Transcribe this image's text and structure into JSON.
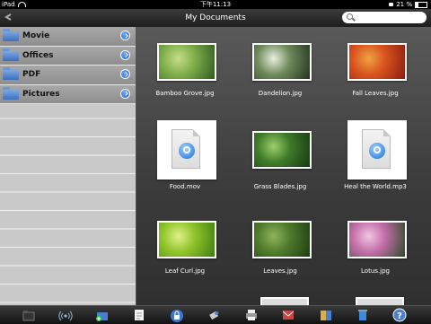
{
  "status": {
    "device": "iPad",
    "time": "下午11:13",
    "battery": "21 %"
  },
  "navbar": {
    "title": "My Documents",
    "search_placeholder": ""
  },
  "sidebar": {
    "items": [
      {
        "label": "Movie"
      },
      {
        "label": "Offices"
      },
      {
        "label": "PDF"
      },
      {
        "label": "Pictures"
      }
    ]
  },
  "files": [
    {
      "name": "Bamboo Grove.jpg",
      "kind": "photo",
      "palette": [
        "#2f5a1e",
        "#7fae4a",
        "#c8dc8a"
      ]
    },
    {
      "name": "Dandelion.jpg",
      "kind": "photo",
      "palette": [
        "#23331f",
        "#6f8a5b",
        "#e8efe0"
      ]
    },
    {
      "name": "Fall Leaves.jpg",
      "kind": "photo",
      "palette": [
        "#8a1c10",
        "#d9531e",
        "#f0a341"
      ]
    },
    {
      "name": "Food.mov",
      "kind": "movie",
      "palette": []
    },
    {
      "name": "Grass Blades.jpg",
      "kind": "photo",
      "palette": [
        "#163a12",
        "#3f7a2a",
        "#9ccf6a"
      ]
    },
    {
      "name": "Heal the World.mp3",
      "kind": "audio",
      "palette": []
    },
    {
      "name": "Leaf Curl.jpg",
      "kind": "photo",
      "palette": [
        "#3f7d12",
        "#8fc42a",
        "#e0f08a"
      ]
    },
    {
      "name": "Leaves.jpg",
      "kind": "photo",
      "palette": [
        "#1e3b12",
        "#4f7b2c",
        "#8fb25a"
      ]
    },
    {
      "name": "Lotus.jpg",
      "kind": "photo",
      "palette": [
        "#2c4a26",
        "#c26da8",
        "#f2c4e0"
      ]
    }
  ],
  "toolbar": {
    "items": [
      "folder-icon",
      "wifi-share-icon",
      "add-folder-icon",
      "notes-icon",
      "lock-icon",
      "usb-icon",
      "printer-icon",
      "mail-icon",
      "books-icon",
      "trash-icon",
      "help-icon"
    ]
  }
}
